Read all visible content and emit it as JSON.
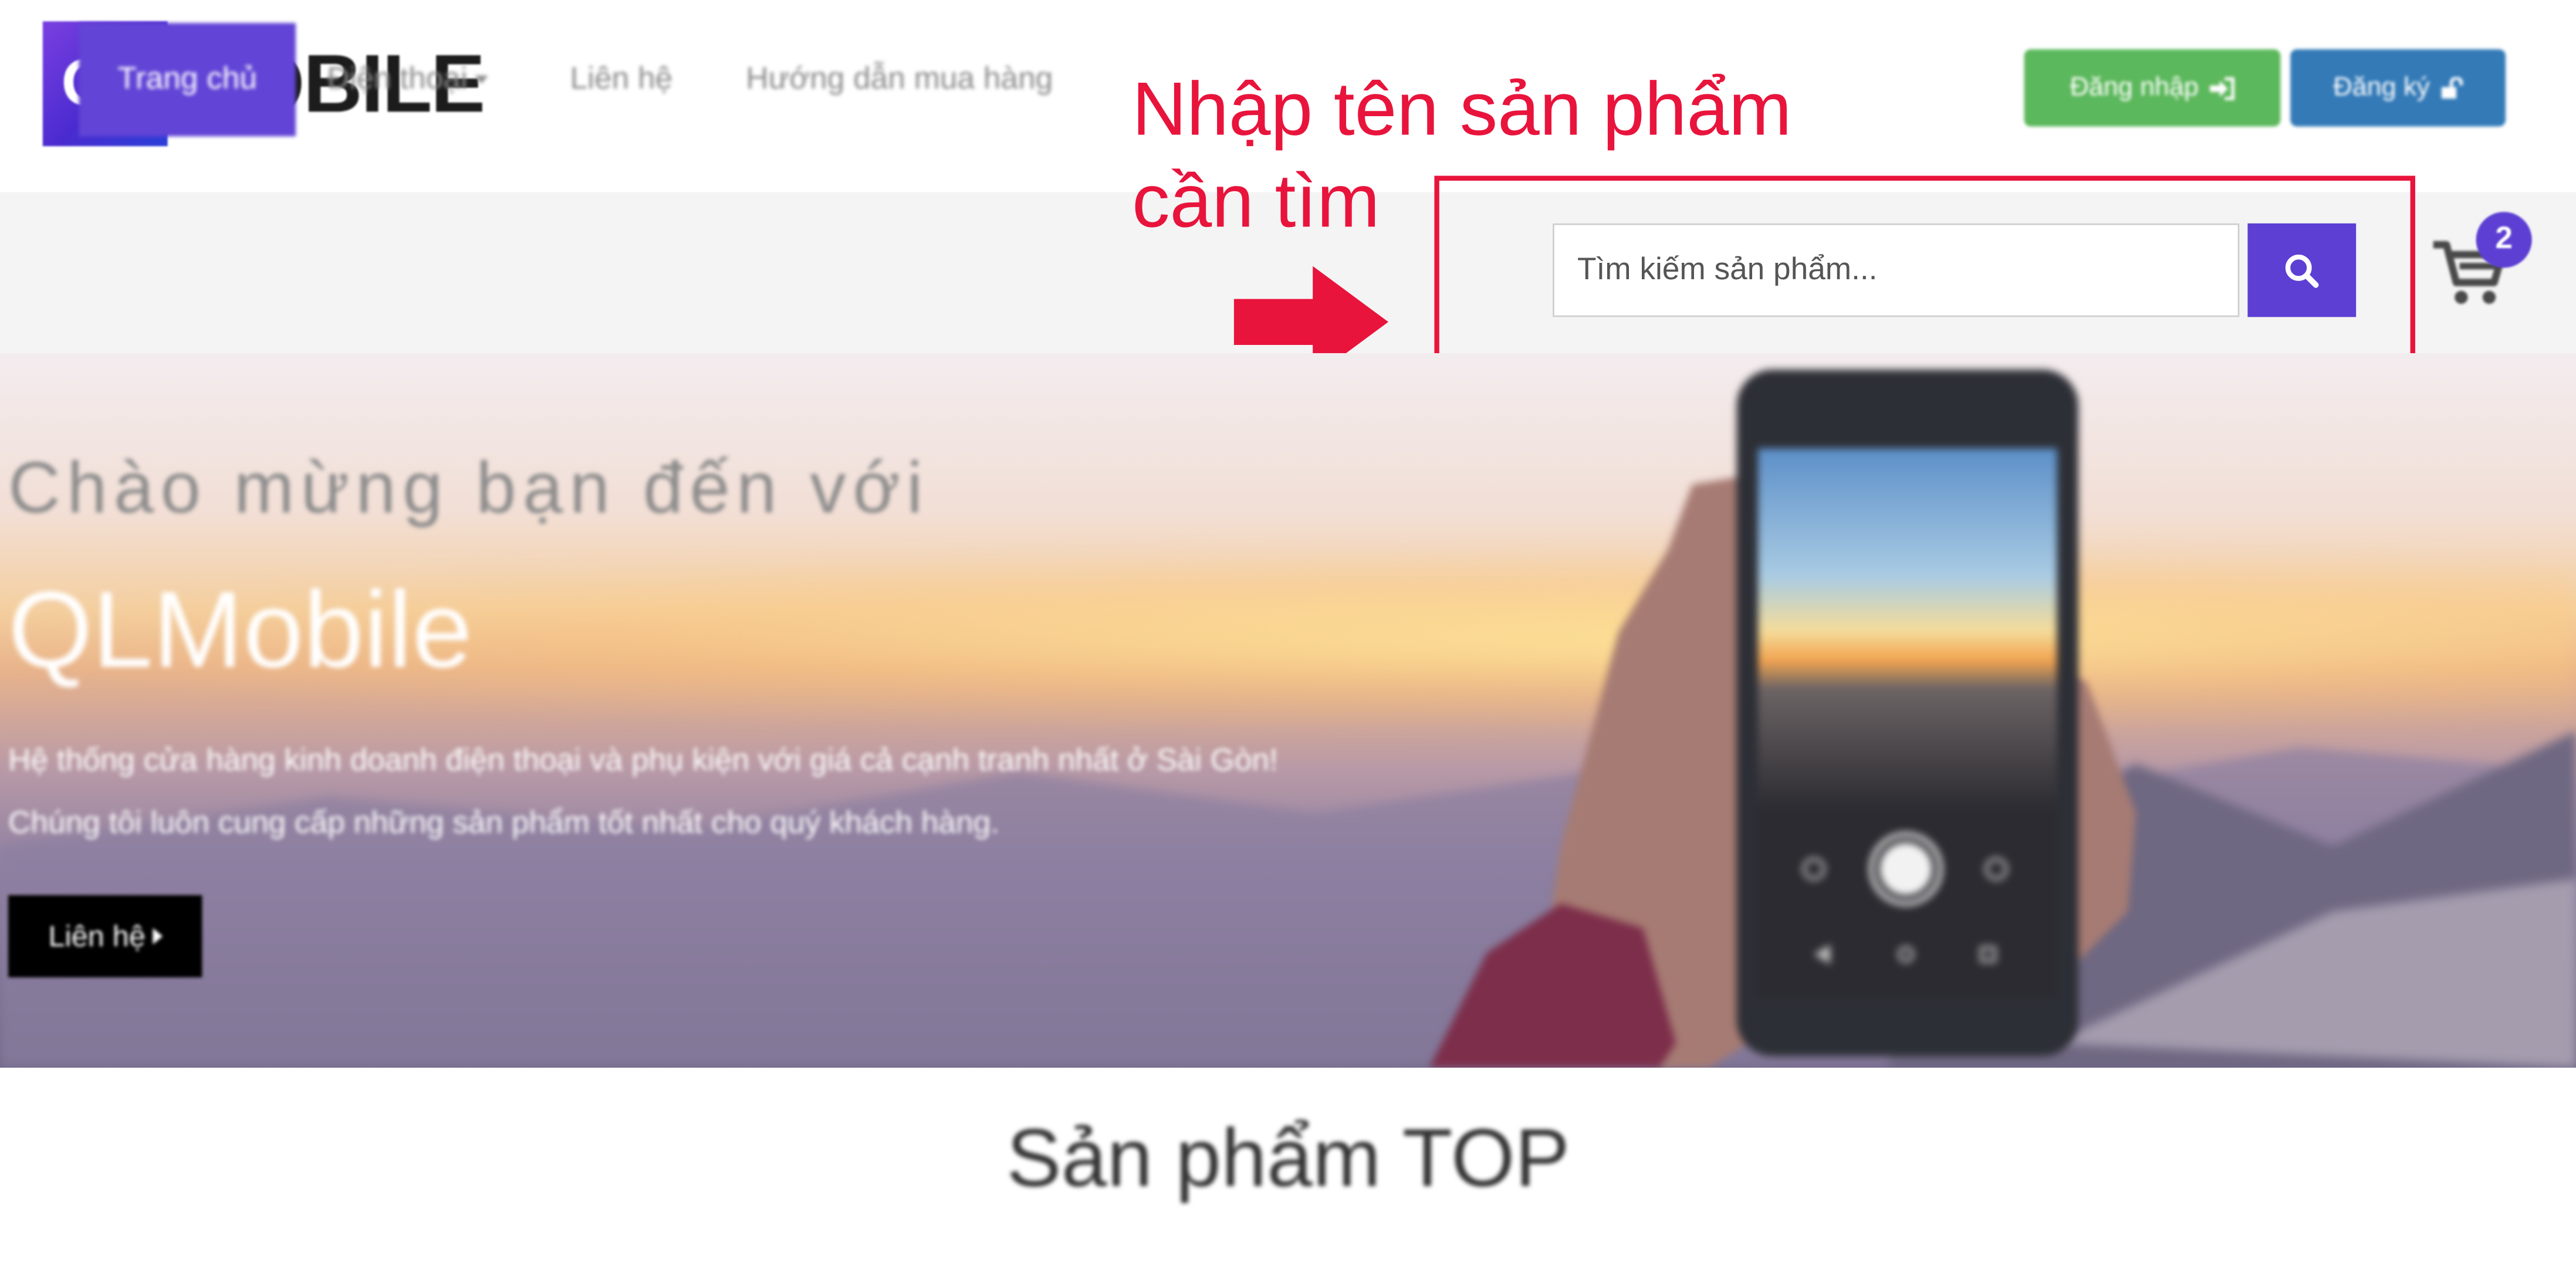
{
  "header": {
    "logo_mark": "QL",
    "logo_word": "MOBILE",
    "login_label": "Đăng nhập",
    "register_label": "Đăng ký"
  },
  "nav": {
    "items": [
      {
        "label": "Trang chủ",
        "active": true
      },
      {
        "label": "Điện thoại",
        "has_dropdown": true
      },
      {
        "label": "Liên hệ"
      },
      {
        "label": "Hướng dẫn mua hàng"
      }
    ],
    "search": {
      "placeholder": "Tìm kiếm sản phẩm..."
    },
    "cart_count": "2"
  },
  "annotation": {
    "text_line1": "Nhập tên sản phẩm",
    "text_line2": "cần tìm",
    "color": "#e8143c"
  },
  "hero": {
    "welcome": "Chào mừng bạn đến với",
    "brand": "QLMobile",
    "description": "Hệ thống cửa hàng kinh doanh điện thoại và phụ kiện với giá cả cạnh tranh nhất ở Sài Gòn! Chúng tôi luôn cung cấp những sản phẩm tốt nhất cho quý khách hàng.",
    "cta_label": "Liên hệ"
  },
  "section": {
    "title": "Sản phẩm TOP"
  },
  "colors": {
    "accent": "#5d3fd3",
    "login_green": "#5cb85c",
    "register_blue": "#337ab7"
  },
  "icons": [
    "sign-in-icon",
    "unlock-icon",
    "caret-down-icon",
    "search-icon",
    "cart-icon",
    "arrow-right-icon",
    "caret-right-icon"
  ]
}
